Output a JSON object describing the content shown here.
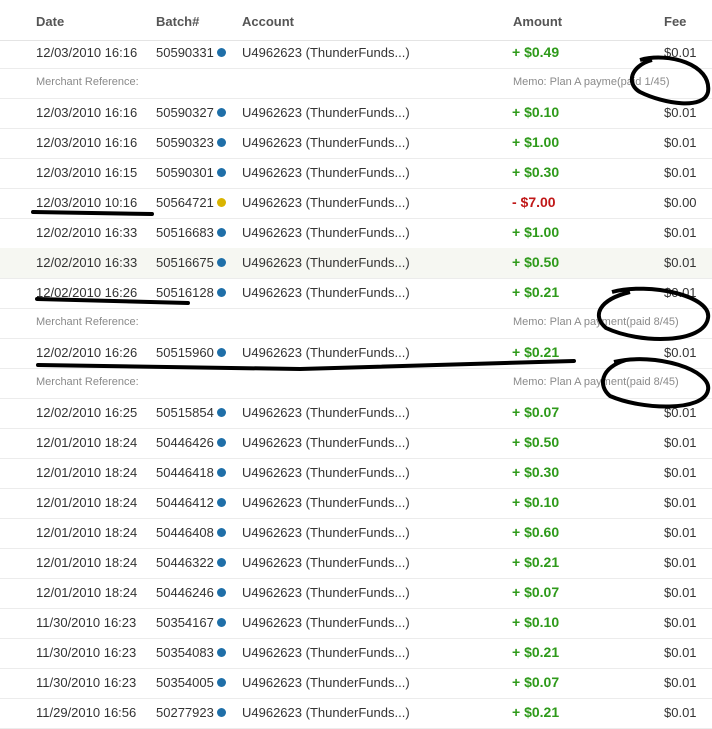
{
  "header": {
    "date": "Date",
    "batch": "Batch#",
    "account": "Account",
    "amount": "Amount",
    "fee": "Fee"
  },
  "colors": {
    "positive": "#2e9a1a",
    "negative": "#c01818",
    "dot_blue": "#1f6fa8",
    "dot_yellow": "#d9b400",
    "annotation_ink": "#000000"
  },
  "rows": [
    {
      "date": "12/03/2010 16:16",
      "batch": "50590331",
      "status": "blue-dot-icon",
      "account": "U4962623 (ThunderFunds...)",
      "amount": "+ $0.49",
      "sign": "pos",
      "fee": "$0.01",
      "alt": false,
      "ref": {
        "label": "Merchant Reference:",
        "memo": "Memo: Plan A payme",
        "memo_tail": "(paid 1/45)"
      }
    },
    {
      "date": "12/03/2010 16:16",
      "batch": "50590327",
      "status": "blue-dot-icon",
      "account": "U4962623 (ThunderFunds...)",
      "amount": "+ $0.10",
      "sign": "pos",
      "fee": "$0.01",
      "alt": false
    },
    {
      "date": "12/03/2010 16:16",
      "batch": "50590323",
      "status": "blue-dot-icon",
      "account": "U4962623 (ThunderFunds...)",
      "amount": "+ $1.00",
      "sign": "pos",
      "fee": "$0.01",
      "alt": false
    },
    {
      "date": "12/03/2010 16:15",
      "batch": "50590301",
      "status": "blue-dot-icon",
      "account": "U4962623 (ThunderFunds...)",
      "amount": "+ $0.30",
      "sign": "pos",
      "fee": "$0.01",
      "alt": false
    },
    {
      "date": "12/03/2010 10:16",
      "batch": "50564721",
      "status": "yellow-dot-icon",
      "account": "U4962623 (ThunderFunds...)",
      "amount": "- $7.00",
      "sign": "neg",
      "fee": "$0.00",
      "alt": false
    },
    {
      "date": "12/02/2010 16:33",
      "batch": "50516683",
      "status": "blue-dot-icon",
      "account": "U4962623 (ThunderFunds...)",
      "amount": "+ $1.00",
      "sign": "pos",
      "fee": "$0.01",
      "alt": false
    },
    {
      "date": "12/02/2010 16:33",
      "batch": "50516675",
      "status": "blue-dot-icon",
      "account": "U4962623 (ThunderFunds...)",
      "amount": "+ $0.50",
      "sign": "pos",
      "fee": "$0.01",
      "alt": true
    },
    {
      "date": "12/02/2010 16:26",
      "batch": "50516128",
      "status": "blue-dot-icon",
      "account": "U4962623 (ThunderFunds...)",
      "amount": "+ $0.21",
      "sign": "pos",
      "fee": "$0.01",
      "alt": false,
      "ref": {
        "label": "Merchant Reference:",
        "memo": "Memo: Plan A pa",
        "memo_tail": "yment(paid 8/45)"
      }
    },
    {
      "date": "12/02/2010 16:26",
      "batch": "50515960",
      "status": "blue-dot-icon",
      "account": "U4962623 (ThunderFunds...)",
      "amount": "+ $0.21",
      "sign": "pos",
      "fee": "$0.01",
      "alt": false,
      "ref": {
        "label": "Merchant Reference:",
        "memo": "Memo: Plan A pa",
        "memo_tail": "yment(paid 8/45)"
      }
    },
    {
      "date": "12/02/2010 16:25",
      "batch": "50515854",
      "status": "blue-dot-icon",
      "account": "U4962623 (ThunderFunds...)",
      "amount": "+ $0.07",
      "sign": "pos",
      "fee": "$0.01",
      "alt": false
    },
    {
      "date": "12/01/2010 18:24",
      "batch": "50446426",
      "status": "blue-dot-icon",
      "account": "U4962623 (ThunderFunds...)",
      "amount": "+ $0.50",
      "sign": "pos",
      "fee": "$0.01",
      "alt": false
    },
    {
      "date": "12/01/2010 18:24",
      "batch": "50446418",
      "status": "blue-dot-icon",
      "account": "U4962623 (ThunderFunds...)",
      "amount": "+ $0.30",
      "sign": "pos",
      "fee": "$0.01",
      "alt": false
    },
    {
      "date": "12/01/2010 18:24",
      "batch": "50446412",
      "status": "blue-dot-icon",
      "account": "U4962623 (ThunderFunds...)",
      "amount": "+ $0.10",
      "sign": "pos",
      "fee": "$0.01",
      "alt": false
    },
    {
      "date": "12/01/2010 18:24",
      "batch": "50446408",
      "status": "blue-dot-icon",
      "account": "U4962623 (ThunderFunds...)",
      "amount": "+ $0.60",
      "sign": "pos",
      "fee": "$0.01",
      "alt": false
    },
    {
      "date": "12/01/2010 18:24",
      "batch": "50446322",
      "status": "blue-dot-icon",
      "account": "U4962623 (ThunderFunds...)",
      "amount": "+ $0.21",
      "sign": "pos",
      "fee": "$0.01",
      "alt": false
    },
    {
      "date": "12/01/2010 18:24",
      "batch": "50446246",
      "status": "blue-dot-icon",
      "account": "U4962623 (ThunderFunds...)",
      "amount": "+ $0.07",
      "sign": "pos",
      "fee": "$0.01",
      "alt": false
    },
    {
      "date": "11/30/2010 16:23",
      "batch": "50354167",
      "status": "blue-dot-icon",
      "account": "U4962623 (ThunderFunds...)",
      "amount": "+ $0.10",
      "sign": "pos",
      "fee": "$0.01",
      "alt": false
    },
    {
      "date": "11/30/2010 16:23",
      "batch": "50354083",
      "status": "blue-dot-icon",
      "account": "U4962623 (ThunderFunds...)",
      "amount": "+ $0.21",
      "sign": "pos",
      "fee": "$0.01",
      "alt": false
    },
    {
      "date": "11/30/2010 16:23",
      "batch": "50354005",
      "status": "blue-dot-icon",
      "account": "U4962623 (ThunderFunds...)",
      "amount": "+ $0.07",
      "sign": "pos",
      "fee": "$0.01",
      "alt": false
    },
    {
      "date": "11/29/2010 16:56",
      "batch": "50277923",
      "status": "blue-dot-icon",
      "account": "U4962623 (ThunderFunds...)",
      "amount": "+ $0.21",
      "sign": "pos",
      "fee": "$0.01",
      "alt": false
    }
  ]
}
